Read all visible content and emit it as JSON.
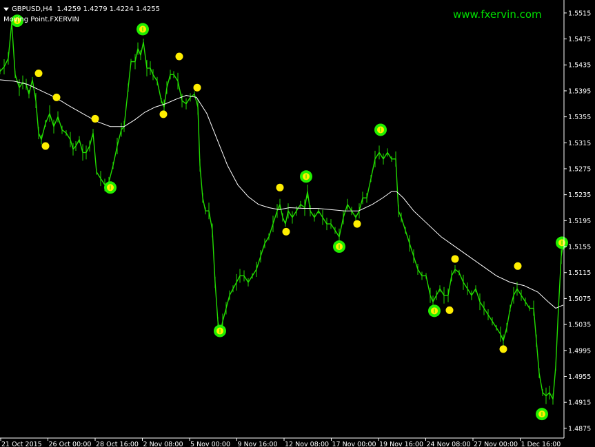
{
  "header": {
    "symbol": "GBPUSD,H4",
    "ohlc": "1.4259 1.4279 1.4224 1.4255",
    "indicator": "Moving Point.FXERVIN"
  },
  "watermark": "www.fxervin.com",
  "colors": {
    "background": "#000000",
    "price_line": "#22dd00",
    "ma_line": "#ffffff",
    "major_marker": "#22ee00",
    "minor_marker": "#ffee00",
    "axis": "#ffffff"
  },
  "chart_data": {
    "type": "line",
    "ylim": [
      1.486,
      1.5535
    ],
    "y_ticks": [
      "1.5515",
      "1.5475",
      "1.5435",
      "1.5395",
      "1.5355",
      "1.5315",
      "1.5275",
      "1.5235",
      "1.5195",
      "1.5155",
      "1.5115",
      "1.5075",
      "1.5035",
      "1.4995",
      "1.4955",
      "1.4915",
      "1.4875"
    ],
    "x_ticks": [
      "21 Oct 2015",
      "26 Oct 00:00",
      "28 Oct 16:00",
      "2 Nov 08:00",
      "5 Nov 00:00",
      "9 Nov 16:00",
      "12 Nov 08:00",
      "17 Nov 00:00",
      "19 Nov 16:00",
      "24 Nov 08:00",
      "27 Nov 00:00",
      "1 Dec 16:00"
    ],
    "x_count": 202,
    "series": [
      {
        "kind": "price",
        "points": [
          [
            0,
            1.5425
          ],
          [
            6,
            1.5432
          ],
          [
            12,
            1.5445
          ],
          [
            17,
            1.55
          ],
          [
            22,
            1.542
          ],
          [
            28,
            1.54
          ],
          [
            33,
            1.5408
          ],
          [
            38,
            1.5405
          ],
          [
            42,
            1.539
          ],
          [
            47,
            1.5412
          ],
          [
            52,
            1.538
          ],
          [
            56,
            1.533
          ],
          [
            60,
            1.532
          ],
          [
            66,
            1.5345
          ],
          [
            72,
            1.536
          ],
          [
            78,
            1.534
          ],
          [
            84,
            1.5355
          ],
          [
            90,
            1.5335
          ],
          [
            96,
            1.533
          ],
          [
            102,
            1.532
          ],
          [
            106,
            1.5305
          ],
          [
            110,
            1.531
          ],
          [
            115,
            1.532
          ],
          [
            120,
            1.53
          ],
          [
            125,
            1.53
          ],
          [
            130,
            1.531
          ],
          [
            135,
            1.533
          ],
          [
            140,
            1.527
          ],
          [
            146,
            1.526
          ],
          [
            152,
            1.525
          ],
          [
            158,
            1.5255
          ],
          [
            164,
            1.528
          ],
          [
            170,
            1.531
          ],
          [
            176,
            1.5335
          ],
          [
            180,
            1.534
          ],
          [
            186,
            1.54
          ],
          [
            190,
            1.544
          ],
          [
            196,
            1.544
          ],
          [
            200,
            1.546
          ],
          [
            204,
            1.545
          ],
          [
            208,
            1.547
          ],
          [
            213,
            1.543
          ],
          [
            218,
            1.543
          ],
          [
            222,
            1.542
          ],
          [
            228,
            1.541
          ],
          [
            234,
            1.538
          ],
          [
            238,
            1.537
          ],
          [
            242,
            1.54
          ],
          [
            247,
            1.542
          ],
          [
            252,
            1.542
          ],
          [
            258,
            1.541
          ],
          [
            264,
            1.538
          ],
          [
            270,
            1.5375
          ],
          [
            276,
            1.5385
          ],
          [
            282,
            1.539
          ],
          [
            287,
            1.537
          ],
          [
            290,
            1.528
          ],
          [
            294,
            1.523
          ],
          [
            298,
            1.521
          ],
          [
            303,
            1.521
          ],
          [
            308,
            1.518
          ],
          [
            312,
            1.51
          ],
          [
            316,
            1.504
          ],
          [
            319,
            1.502
          ],
          [
            323,
            1.504
          ],
          [
            328,
            1.506
          ],
          [
            333,
            1.508
          ],
          [
            338,
            1.509
          ],
          [
            343,
            1.51
          ],
          [
            348,
            1.511
          ],
          [
            354,
            1.511
          ],
          [
            360,
            1.51
          ],
          [
            366,
            1.511
          ],
          [
            372,
            1.512
          ],
          [
            378,
            1.514
          ],
          [
            384,
            1.516
          ],
          [
            390,
            1.517
          ],
          [
            396,
            1.519
          ],
          [
            402,
            1.521
          ],
          [
            406,
            1.522
          ],
          [
            410,
            1.52
          ],
          [
            414,
            1.519
          ],
          [
            418,
            1.521
          ],
          [
            424,
            1.52
          ],
          [
            430,
            1.521
          ],
          [
            436,
            1.522
          ],
          [
            442,
            1.5215
          ],
          [
            446,
            1.524
          ],
          [
            450,
            1.521
          ],
          [
            456,
            1.52
          ],
          [
            462,
            1.521
          ],
          [
            468,
            1.52
          ],
          [
            474,
            1.519
          ],
          [
            480,
            1.519
          ],
          [
            486,
            1.518
          ],
          [
            492,
            1.517
          ],
          [
            498,
            1.52
          ],
          [
            504,
            1.522
          ],
          [
            510,
            1.521
          ],
          [
            516,
            1.52
          ],
          [
            521,
            1.521
          ],
          [
            526,
            1.523
          ],
          [
            532,
            1.523
          ],
          [
            538,
            1.526
          ],
          [
            544,
            1.529
          ],
          [
            550,
            1.53
          ],
          [
            556,
            1.529
          ],
          [
            562,
            1.53
          ],
          [
            568,
            1.529
          ],
          [
            574,
            1.529
          ],
          [
            578,
            1.521
          ],
          [
            582,
            1.52
          ],
          [
            588,
            1.518
          ],
          [
            594,
            1.516
          ],
          [
            600,
            1.514
          ],
          [
            606,
            1.512
          ],
          [
            612,
            1.511
          ],
          [
            618,
            1.511
          ],
          [
            624,
            1.508
          ],
          [
            628,
            1.507
          ],
          [
            633,
            1.508
          ],
          [
            638,
            1.509
          ],
          [
            644,
            1.508
          ],
          [
            650,
            1.508
          ],
          [
            655,
            1.511
          ],
          [
            660,
            1.512
          ],
          [
            666,
            1.5115
          ],
          [
            672,
            1.51
          ],
          [
            678,
            1.509
          ],
          [
            684,
            1.508
          ],
          [
            690,
            1.509
          ],
          [
            696,
            1.507
          ],
          [
            702,
            1.506
          ],
          [
            708,
            1.505
          ],
          [
            714,
            1.504
          ],
          [
            720,
            1.503
          ],
          [
            726,
            1.502
          ],
          [
            730,
            1.501
          ],
          [
            735,
            1.503
          ],
          [
            740,
            1.506
          ],
          [
            745,
            1.508
          ],
          [
            750,
            1.509
          ],
          [
            756,
            1.508
          ],
          [
            762,
            1.507
          ],
          [
            768,
            1.506
          ],
          [
            774,
            1.506
          ],
          [
            778,
            1.501
          ],
          [
            782,
            1.496
          ],
          [
            787,
            1.493
          ],
          [
            792,
            1.4925
          ],
          [
            797,
            1.493
          ],
          [
            802,
            1.492
          ],
          [
            806,
            1.497
          ],
          [
            810,
            1.506
          ],
          [
            814,
            1.514
          ],
          [
            817,
            1.516
          ]
        ]
      },
      {
        "kind": "moving_average",
        "points": [
          [
            0,
            1.5412
          ],
          [
            20,
            1.541
          ],
          [
            40,
            1.5405
          ],
          [
            60,
            1.5395
          ],
          [
            80,
            1.5385
          ],
          [
            100,
            1.5372
          ],
          [
            120,
            1.536
          ],
          [
            140,
            1.5348
          ],
          [
            160,
            1.534
          ],
          [
            180,
            1.534
          ],
          [
            195,
            1.535
          ],
          [
            210,
            1.5362
          ],
          [
            225,
            1.537
          ],
          [
            240,
            1.5375
          ],
          [
            255,
            1.5382
          ],
          [
            270,
            1.5388
          ],
          [
            285,
            1.5385
          ],
          [
            300,
            1.536
          ],
          [
            315,
            1.532
          ],
          [
            330,
            1.528
          ],
          [
            345,
            1.525
          ],
          [
            360,
            1.5232
          ],
          [
            375,
            1.522
          ],
          [
            390,
            1.5215
          ],
          [
            405,
            1.5212
          ],
          [
            420,
            1.5215
          ],
          [
            440,
            1.5214
          ],
          [
            460,
            1.5214
          ],
          [
            480,
            1.5212
          ],
          [
            500,
            1.521
          ],
          [
            520,
            1.521
          ],
          [
            540,
            1.522
          ],
          [
            555,
            1.523
          ],
          [
            568,
            1.524
          ],
          [
            575,
            1.524
          ],
          [
            585,
            1.523
          ],
          [
            600,
            1.521
          ],
          [
            620,
            1.519
          ],
          [
            640,
            1.517
          ],
          [
            660,
            1.5155
          ],
          [
            680,
            1.514
          ],
          [
            700,
            1.5125
          ],
          [
            720,
            1.511
          ],
          [
            740,
            1.51
          ],
          [
            760,
            1.5095
          ],
          [
            780,
            1.5085
          ],
          [
            795,
            1.507
          ],
          [
            806,
            1.506
          ],
          [
            817,
            1.5065
          ]
        ]
      }
    ],
    "markers": [
      {
        "x": 25,
        "y": 1.5503,
        "type": "major"
      },
      {
        "x": 56,
        "y": 1.5422,
        "type": "minor"
      },
      {
        "x": 66,
        "y": 1.531,
        "type": "minor"
      },
      {
        "x": 82,
        "y": 1.5385,
        "type": "minor"
      },
      {
        "x": 138,
        "y": 1.5352,
        "type": "minor"
      },
      {
        "x": 160,
        "y": 1.5246,
        "type": "major"
      },
      {
        "x": 207,
        "y": 1.549,
        "type": "major"
      },
      {
        "x": 237,
        "y": 1.5359,
        "type": "minor"
      },
      {
        "x": 260,
        "y": 1.5448,
        "type": "minor"
      },
      {
        "x": 286,
        "y": 1.54,
        "type": "minor"
      },
      {
        "x": 319,
        "y": 1.5025,
        "type": "major"
      },
      {
        "x": 406,
        "y": 1.5246,
        "type": "minor"
      },
      {
        "x": 415,
        "y": 1.5178,
        "type": "minor"
      },
      {
        "x": 444,
        "y": 1.5263,
        "type": "major"
      },
      {
        "x": 492,
        "y": 1.5155,
        "type": "major"
      },
      {
        "x": 518,
        "y": 1.519,
        "type": "minor"
      },
      {
        "x": 552,
        "y": 1.5335,
        "type": "major"
      },
      {
        "x": 630,
        "y": 1.5056,
        "type": "major"
      },
      {
        "x": 652,
        "y": 1.5057,
        "type": "minor"
      },
      {
        "x": 660,
        "y": 1.5136,
        "type": "minor"
      },
      {
        "x": 730,
        "y": 1.4997,
        "type": "minor"
      },
      {
        "x": 751,
        "y": 1.5125,
        "type": "minor"
      },
      {
        "x": 786,
        "y": 1.4897,
        "type": "major"
      },
      {
        "x": 815,
        "y": 1.5161,
        "type": "major"
      }
    ],
    "grid": false
  }
}
